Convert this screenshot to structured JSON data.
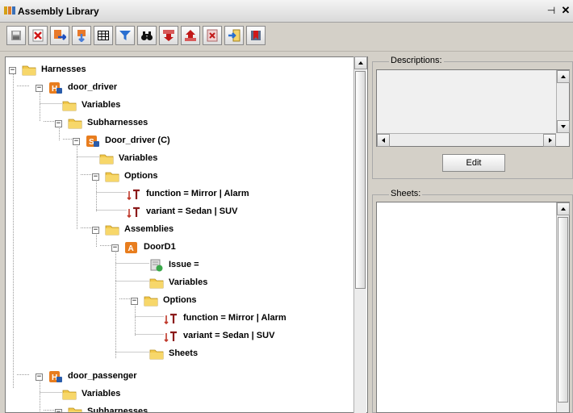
{
  "window": {
    "title": "Assembly Library",
    "pin_glyph": "⊣",
    "close_glyph": "✕"
  },
  "toolbar": {
    "buttons": [
      {
        "name": "save-button",
        "icon": "disk-icon"
      },
      {
        "name": "delete-button",
        "icon": "red-x-icon"
      },
      {
        "name": "import-button",
        "icon": "import-arrow-icon"
      },
      {
        "name": "export-button",
        "icon": "export-arrow-icon"
      },
      {
        "name": "grid-view-button",
        "icon": "table-icon"
      },
      {
        "name": "filter-button",
        "icon": "funnel-icon"
      },
      {
        "name": "find-button",
        "icon": "binoculars-icon"
      },
      {
        "name": "move-down-button",
        "icon": "red-down-arrow-icon"
      },
      {
        "name": "move-up-button",
        "icon": "red-up-arrow-icon"
      },
      {
        "name": "remove-button",
        "icon": "red-x-doc-icon"
      },
      {
        "name": "insert-button",
        "icon": "insert-arrow-icon"
      },
      {
        "name": "bookmark-button",
        "icon": "red-bookmark-icon"
      }
    ]
  },
  "tree": {
    "nodes": [
      {
        "label": "Harnesses",
        "icon": "folder",
        "expander": "−"
      },
      {
        "label": "door_driver",
        "icon": "harness",
        "expander": "−"
      },
      {
        "label": "Variables",
        "icon": "folder",
        "expander": ""
      },
      {
        "label": "Subharnesses",
        "icon": "folder",
        "expander": "−"
      },
      {
        "label": "Door_driver (C)",
        "icon": "subharness",
        "expander": "−"
      },
      {
        "label": "Variables",
        "icon": "folder",
        "expander": ""
      },
      {
        "label": "Options",
        "icon": "folder",
        "expander": "−"
      },
      {
        "label": "function = Mirror | Alarm",
        "icon": "option",
        "expander": ""
      },
      {
        "label": "variant = Sedan | SUV",
        "icon": "option",
        "expander": ""
      },
      {
        "label": "Assemblies",
        "icon": "folder",
        "expander": "−"
      },
      {
        "label": "DoorD1",
        "icon": "assembly",
        "expander": "−"
      },
      {
        "label": "Issue =",
        "icon": "issue",
        "expander": ""
      },
      {
        "label": "Variables",
        "icon": "folder",
        "expander": ""
      },
      {
        "label": "Options",
        "icon": "folder",
        "expander": "−"
      },
      {
        "label": "function = Mirror | Alarm",
        "icon": "option",
        "expander": ""
      },
      {
        "label": "variant = Sedan | SUV",
        "icon": "option",
        "expander": ""
      },
      {
        "label": "Sheets",
        "icon": "folder",
        "expander": ""
      },
      {
        "label": "door_passenger",
        "icon": "harness",
        "expander": "−"
      },
      {
        "label": "Variables",
        "icon": "folder",
        "expander": ""
      },
      {
        "label": "Subharnesses",
        "icon": "folder",
        "expander": "−"
      }
    ]
  },
  "descriptions": {
    "title": "Descriptions:",
    "value": "",
    "edit_label": "Edit"
  },
  "sheets": {
    "title": "Sheets:"
  },
  "colors": {
    "folder": "#f2c84b",
    "harness_orange": "#e87d1e",
    "lock_blue": "#2a5caa",
    "option_red": "#c0392b",
    "issue_green": "#3aa84a"
  }
}
